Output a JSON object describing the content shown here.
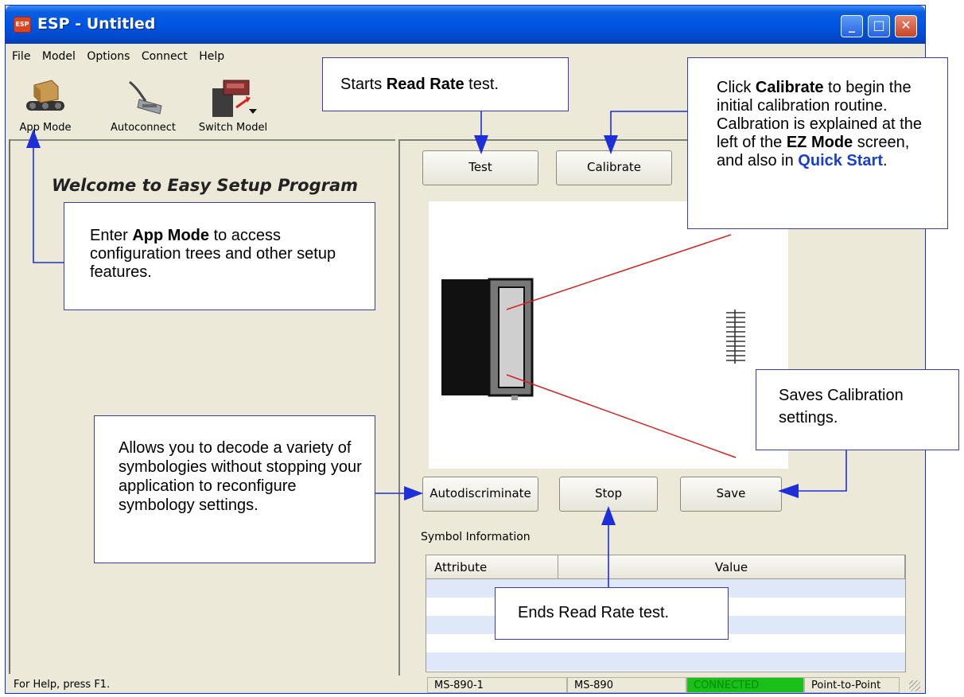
{
  "window": {
    "title": "ESP - Untitled",
    "app_icon_text": "ESP",
    "controls": {
      "minimize": "_",
      "maximize": "□",
      "close": "✕"
    }
  },
  "menu": [
    "File",
    "Model",
    "Options",
    "Connect",
    "Help"
  ],
  "toolbar": {
    "app_mode": "App Mode",
    "autoconnect": "Autoconnect",
    "switch_model": "Switch Model"
  },
  "left_panel": {
    "welcome": "Welcome to Easy Setup Program"
  },
  "right_panel": {
    "test": "Test",
    "calibrate": "Calibrate",
    "autodiscriminate": "Autodiscriminate",
    "stop": "Stop",
    "save": "Save",
    "symbol_info_label": "Symbol Information",
    "table_headers": [
      "Attribute",
      "Value"
    ]
  },
  "status_bar": {
    "help": "For Help, press F1.",
    "model_id": "MS-890-1",
    "model": "MS-890",
    "connection": "CONNECTED",
    "mode": "Point-to-Point"
  },
  "callouts": {
    "read_rate": {
      "pre": "Starts ",
      "bold": "Read Rate",
      "post": " test."
    },
    "calibrate": {
      "l1": "Click ",
      "b1": "Calibrate",
      "l2": " to begin the initial calibration routine. Calbration is explained at the left of the ",
      "b2": "EZ Mode",
      "l3": " screen, and also in ",
      "link": "Quick Start",
      "l4": "."
    },
    "app_mode": {
      "pre": "Enter ",
      "bold": "App Mode",
      "post": " to access configuration trees and other setup features."
    },
    "saves": "Saves Calibration settings.",
    "autodiscriminate": "Allows you to decode a variety of symbologies without stopping your application to reconfigure symbology settings.",
    "ends": "Ends Read Rate test."
  },
  "colors": {
    "connected_bg": "#18c018",
    "connected_text": "#008800",
    "arrow": "#1f2fd8",
    "laser": "#d42020"
  }
}
